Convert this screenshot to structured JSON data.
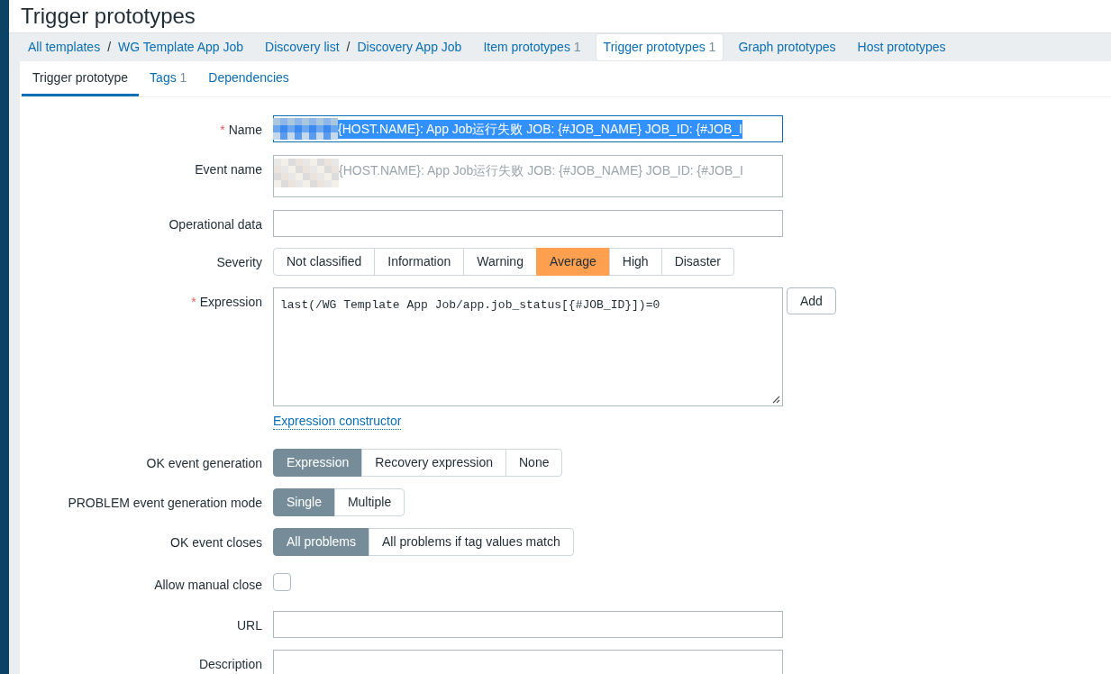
{
  "page_title": "Trigger prototypes",
  "nav": [
    {
      "kind": "path",
      "separator": "/",
      "items": [
        "All templates",
        "WG Template App Job"
      ]
    },
    {
      "kind": "path",
      "separator": "/",
      "items": [
        "Discovery list",
        "Discovery App Job"
      ]
    },
    {
      "kind": "tab",
      "label": "Item prototypes",
      "count": "1",
      "selected": false
    },
    {
      "kind": "tab",
      "label": "Trigger prototypes",
      "count": "1",
      "selected": true
    },
    {
      "kind": "tab",
      "label": "Graph prototypes",
      "selected": false
    },
    {
      "kind": "tab",
      "label": "Host prototypes",
      "selected": false
    }
  ],
  "form_tabs": [
    {
      "label": "Trigger prototype",
      "selected": true
    },
    {
      "label": "Tags",
      "count": "1",
      "selected": false
    },
    {
      "label": "Dependencies",
      "selected": false
    }
  ],
  "rows": [
    {
      "kind": "text",
      "label": "Name",
      "required_mark": "*",
      "redacted": true,
      "value": "{HOST.NAME}: App Job运行失败 JOB: {#JOB_NAME} JOB_ID: {#JOB_I",
      "highlighted": true
    },
    {
      "kind": "textarea",
      "label": "Event name",
      "redacted": true,
      "placeholder": "{HOST.NAME}: App Job运行失败 JOB: {#JOB_NAME} JOB_ID: {#JOB_I"
    },
    {
      "kind": "text",
      "label": "Operational data"
    },
    {
      "kind": "severity",
      "label": "Severity",
      "options": [
        {
          "label": "Not classified",
          "selected": false
        },
        {
          "label": "Information",
          "selected": false
        },
        {
          "label": "Warning",
          "selected": false
        },
        {
          "label": "Average",
          "selected": true
        },
        {
          "label": "High",
          "selected": false
        },
        {
          "label": "Disaster",
          "selected": false
        }
      ]
    },
    {
      "kind": "expression",
      "label": "Expression",
      "required_mark": "*",
      "value": "last(/WG Template App Job/app.job_status[{#JOB_ID}])=0",
      "button": "Add",
      "link": "Expression constructor"
    },
    {
      "kind": "segmented",
      "label": "OK event generation",
      "options": [
        {
          "label": "Expression",
          "selected": true
        },
        {
          "label": "Recovery expression",
          "selected": false
        },
        {
          "label": "None",
          "selected": false
        }
      ]
    },
    {
      "kind": "segmented",
      "label": "PROBLEM event generation mode",
      "options": [
        {
          "label": "Single",
          "selected": true
        },
        {
          "label": "Multiple",
          "selected": false
        }
      ]
    },
    {
      "kind": "segmented",
      "label": "OK event closes",
      "options": [
        {
          "label": "All problems",
          "selected": true
        },
        {
          "label": "All problems if tag values match",
          "selected": false
        }
      ]
    },
    {
      "kind": "checkbox",
      "label": "Allow manual close",
      "checked": false
    },
    {
      "kind": "text",
      "label": "URL"
    },
    {
      "kind": "text",
      "label": "Description"
    }
  ]
}
